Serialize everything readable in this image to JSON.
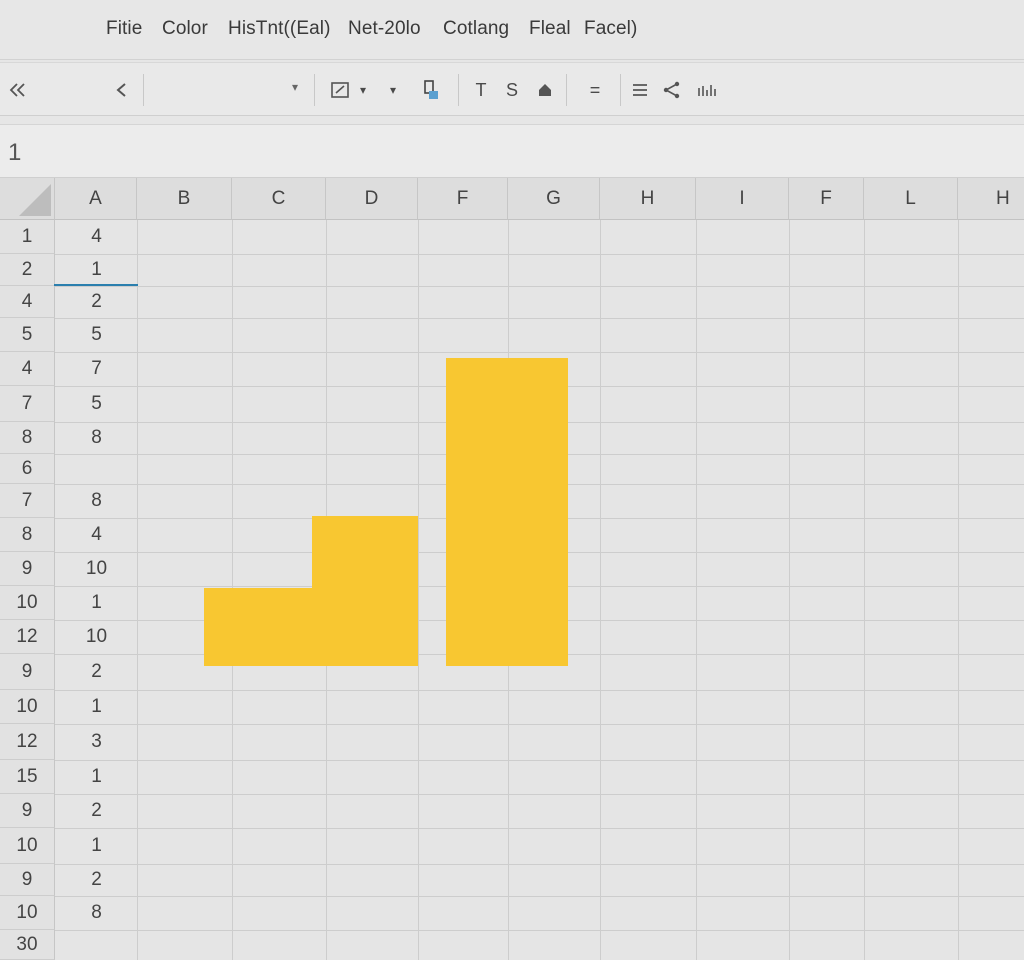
{
  "menu": [
    "Fitie",
    "Color",
    "HisTnt((Eal)",
    "Net-20lo",
    "Cotlang",
    "Fleal",
    "Facel)"
  ],
  "toolbar": {
    "collapse_icon": "double-chevron-icon",
    "back_icon": "chevron-left-icon",
    "font_dropdown_arrow": "▾",
    "border_button": "border-icon",
    "dropdown_arrow": "▾",
    "format_painter": "format-painter-icon",
    "text_label": "T",
    "strike_label": "S",
    "fill_icon": "fill-bucket-icon",
    "equals_label": "=",
    "align_icon": "align-icon",
    "share_icon": "share-icon",
    "chart_icon": "bar-chart-icon"
  },
  "formula_bar": {
    "cell_ref": "1"
  },
  "grid": {
    "columns": [
      "A",
      "B",
      "C",
      "D",
      "F",
      "G",
      "H",
      "I",
      "F",
      "L",
      "H"
    ],
    "rows": [
      {
        "label": "1",
        "a": "4"
      },
      {
        "label": "2",
        "a": "1"
      },
      {
        "label": "4",
        "a": "2"
      },
      {
        "label": "5",
        "a": "5"
      },
      {
        "label": "4",
        "a": "7"
      },
      {
        "label": "7",
        "a": "5"
      },
      {
        "label": "8",
        "a": "8"
      },
      {
        "label": "6",
        "a": ""
      },
      {
        "label": "7",
        "a": "8"
      },
      {
        "label": "8",
        "a": "4"
      },
      {
        "label": "9",
        "a": "10"
      },
      {
        "label": "10",
        "a": "1"
      },
      {
        "label": "12",
        "a": "10"
      },
      {
        "label": "9",
        "a": "2"
      },
      {
        "label": "10",
        "a": "1"
      },
      {
        "label": "12",
        "a": "3"
      },
      {
        "label": "15",
        "a": "1"
      },
      {
        "label": "9",
        "a": "2"
      },
      {
        "label": "10",
        "a": "1"
      },
      {
        "label": "9",
        "a": "2"
      },
      {
        "label": "10",
        "a": "8"
      },
      {
        "label": "30",
        "a": ""
      }
    ]
  },
  "colors": {
    "bar": "#f8c731",
    "selection": "#2b7fae"
  }
}
